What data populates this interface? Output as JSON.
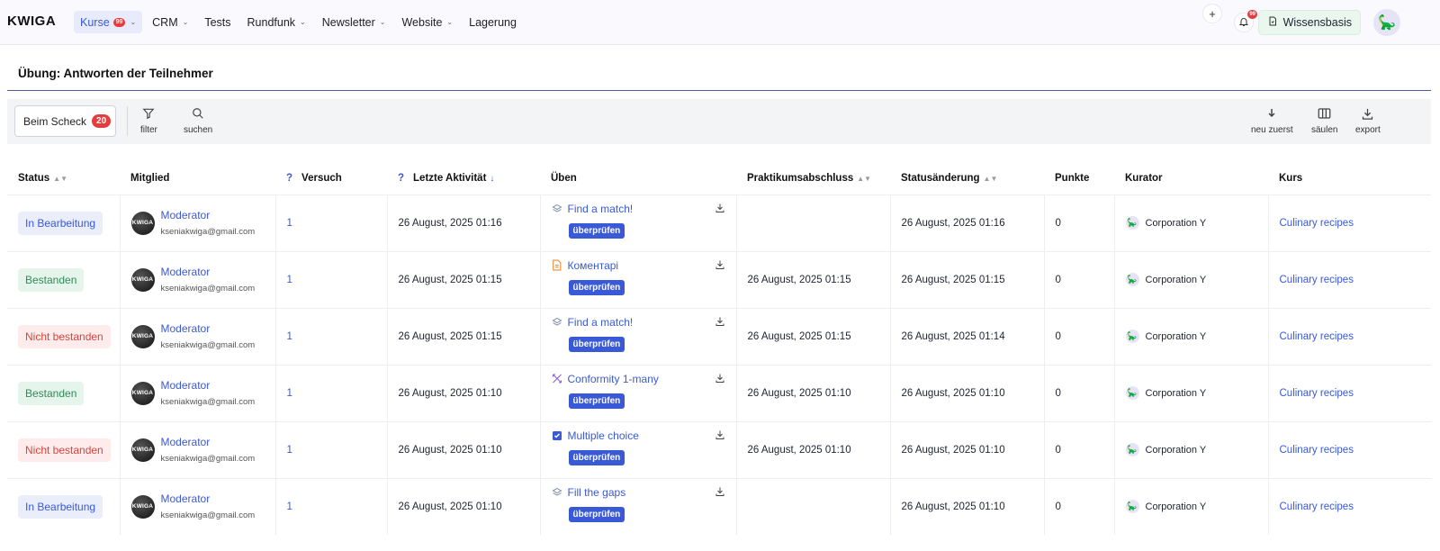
{
  "app": {
    "logo": "KWIGA",
    "nav": [
      {
        "label": "Kurse",
        "badge": "99",
        "dropdown": true,
        "active": true
      },
      {
        "label": "CRM",
        "dropdown": true
      },
      {
        "label": "Tests",
        "dropdown": false
      },
      {
        "label": "Rundfunk",
        "dropdown": true
      },
      {
        "label": "Newsletter",
        "dropdown": true
      },
      {
        "label": "Website",
        "dropdown": true
      },
      {
        "label": "Lagerung",
        "dropdown": false
      }
    ],
    "plus_icon": "+",
    "notifications_badge": "99",
    "knowledge_base_label": "Wissensbasis"
  },
  "page": {
    "title": "Übung: Antworten der Teilnehmer"
  },
  "toolbar": {
    "scheck_label": "Beim Scheck",
    "scheck_count": "20",
    "filter_label": "filter",
    "search_label": "suchen",
    "sort_label": "neu zuerst",
    "columns_label": "säulen",
    "export_label": "export"
  },
  "table": {
    "headers": {
      "status": "Status",
      "member": "Mitglied",
      "attempt": "Versuch",
      "last_activity": "Letzte Aktivität",
      "exercise": "Üben",
      "completion": "Praktikumsabschluss",
      "status_change": "Statusänderung",
      "points": "Punkte",
      "curator": "Kurator",
      "course": "Kurs",
      "help_mark": "?"
    },
    "review_label": "überprüfen",
    "rows": [
      {
        "status": "In Bearbeitung",
        "status_type": "blue",
        "avatar_text": "KWIGA",
        "member_name": "Moderator",
        "member_email": "kseniakwiga@gmail.com",
        "attempt": "1",
        "last_activity": "26 August, 2025 01:16",
        "exercise_icon": "layers-icon",
        "exercise": "Find a match!",
        "completion": "",
        "status_change": "26 August, 2025 01:16",
        "points": "0",
        "curator": "Corporation Y",
        "course": "Culinary recipes"
      },
      {
        "status": "Bestanden",
        "status_type": "green",
        "avatar_text": "KWIGA",
        "member_name": "Moderator",
        "member_email": "kseniakwiga@gmail.com",
        "attempt": "1",
        "last_activity": "26 August, 2025 01:15",
        "exercise_icon": "document-icon",
        "exercise": "Коментарі",
        "completion": "26 August, 2025 01:15",
        "status_change": "26 August, 2025 01:15",
        "points": "0",
        "curator": "Corporation Y",
        "course": "Culinary recipes"
      },
      {
        "status": "Nicht bestanden",
        "status_type": "red",
        "avatar_text": "KWIGA",
        "member_name": "Moderator",
        "member_email": "kseniakwiga@gmail.com",
        "attempt": "1",
        "last_activity": "26 August, 2025 01:15",
        "exercise_icon": "layers-icon",
        "exercise": "Find a match!",
        "completion": "26 August, 2025 01:15",
        "status_change": "26 August, 2025 01:14",
        "points": "0",
        "curator": "Corporation Y",
        "course": "Culinary recipes"
      },
      {
        "status": "Bestanden",
        "status_type": "green",
        "avatar_text": "KWIGA",
        "member_name": "Moderator",
        "member_email": "kseniakwiga@gmail.com",
        "attempt": "1",
        "last_activity": "26 August, 2025 01:10",
        "exercise_icon": "conformity-icon",
        "exercise": "Conformity 1-many",
        "completion": "26 August, 2025 01:10",
        "status_change": "26 August, 2025 01:10",
        "points": "0",
        "curator": "Corporation Y",
        "course": "Culinary recipes"
      },
      {
        "status": "Nicht bestanden",
        "status_type": "red",
        "avatar_text": "KWIGA",
        "member_name": "Moderator",
        "member_email": "kseniakwiga@gmail.com",
        "attempt": "1",
        "last_activity": "26 August, 2025 01:10",
        "exercise_icon": "checkbox-icon",
        "exercise": "Multiple choice",
        "completion": "26 August, 2025 01:10",
        "status_change": "26 August, 2025 01:10",
        "points": "0",
        "curator": "Corporation Y",
        "course": "Culinary recipes"
      },
      {
        "status": "In Bearbeitung",
        "status_type": "blue",
        "avatar_text": "KWIGA",
        "member_name": "Moderator",
        "member_email": "kseniakwiga@gmail.com",
        "attempt": "1",
        "last_activity": "26 August, 2025 01:10",
        "exercise_icon": "layers-icon",
        "exercise": "Fill the gaps",
        "completion": "",
        "status_change": "26 August, 2025 01:10",
        "points": "0",
        "curator": "Corporation Y",
        "course": "Culinary recipes"
      }
    ]
  }
}
